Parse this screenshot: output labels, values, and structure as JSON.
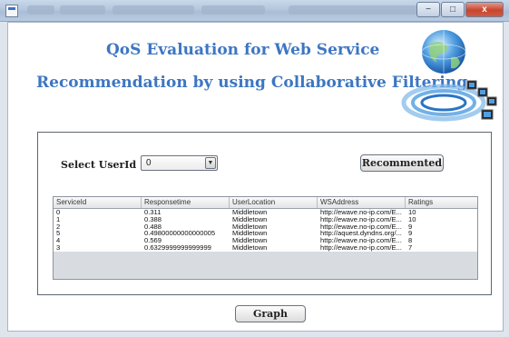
{
  "window": {
    "icon": "app-window-icon",
    "controls": {
      "minimize": "−",
      "maximize": "□",
      "close": "x"
    }
  },
  "header": {
    "title_line1": "QoS Evaluation for Web Service",
    "title_line2": "Recommendation by  using Collaborative Filtering",
    "illustration": "globe-network-icon"
  },
  "form": {
    "select_label": "Select UserId",
    "select_value": "0",
    "recommend_button": "Recommented"
  },
  "table": {
    "columns": [
      "ServiceId",
      "Responsetime",
      "UserLocation",
      "WSAddress",
      "Ratings"
    ],
    "rows": [
      [
        "0",
        "0.311",
        "Middletown",
        "http://ewave.no-ip.com/E...",
        "10"
      ],
      [
        "1",
        "0.388",
        "Middletown",
        "http://ewave.no-ip.com/E...",
        "10"
      ],
      [
        "2",
        "0.488",
        "Middletown",
        "http://ewave.no-ip.com/E...",
        "9"
      ],
      [
        "5",
        "0.49800000000000005",
        "Middletown",
        "http://aquest.dyndns.org/...",
        "9"
      ],
      [
        "4",
        "0.569",
        "Middletown",
        "http://ewave.no-ip.com/E...",
        "8"
      ],
      [
        "3",
        "0.6329999999999999",
        "Middletown",
        "http://ewave.no-ip.com/E...",
        "7"
      ]
    ]
  },
  "footer": {
    "graph_button": "Graph"
  },
  "colors": {
    "title": "#3d76c2",
    "titlebar": "#b4c7de",
    "close": "#c8452f"
  }
}
